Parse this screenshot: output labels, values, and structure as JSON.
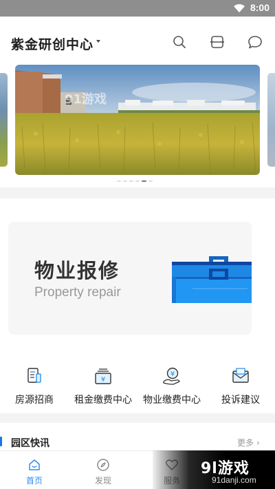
{
  "status_bar": {
    "time": "8:00"
  },
  "header": {
    "title": "紫金研创中心",
    "icons": [
      "search-icon",
      "scan-icon",
      "message-icon"
    ]
  },
  "banner": {
    "watermark_text": "91游戏",
    "slide_count": 6,
    "active_slide": 5
  },
  "promo_card": {
    "title": "物业报修",
    "subtitle": "Property repair"
  },
  "quick_menu": [
    {
      "label": "房源招商",
      "icon": "document-icon"
    },
    {
      "label": "租金缴费中心",
      "icon": "rent-payment-icon"
    },
    {
      "label": "物业缴费中心",
      "icon": "property-payment-icon"
    },
    {
      "label": "投诉建议",
      "icon": "mail-icon"
    }
  ],
  "news": {
    "title": "园区快讯",
    "more": "更多"
  },
  "tabbar": [
    {
      "label": "首页",
      "icon": "home-icon",
      "active": true
    },
    {
      "label": "发现",
      "icon": "compass-icon",
      "active": false
    },
    {
      "label": "服务",
      "icon": "heart-icon",
      "active": false
    }
  ],
  "watermark": {
    "main": "9l游戏",
    "sub": "91danji.com"
  },
  "colors": {
    "accent": "#2f8cf0",
    "toolbox": "#1e88e5"
  }
}
